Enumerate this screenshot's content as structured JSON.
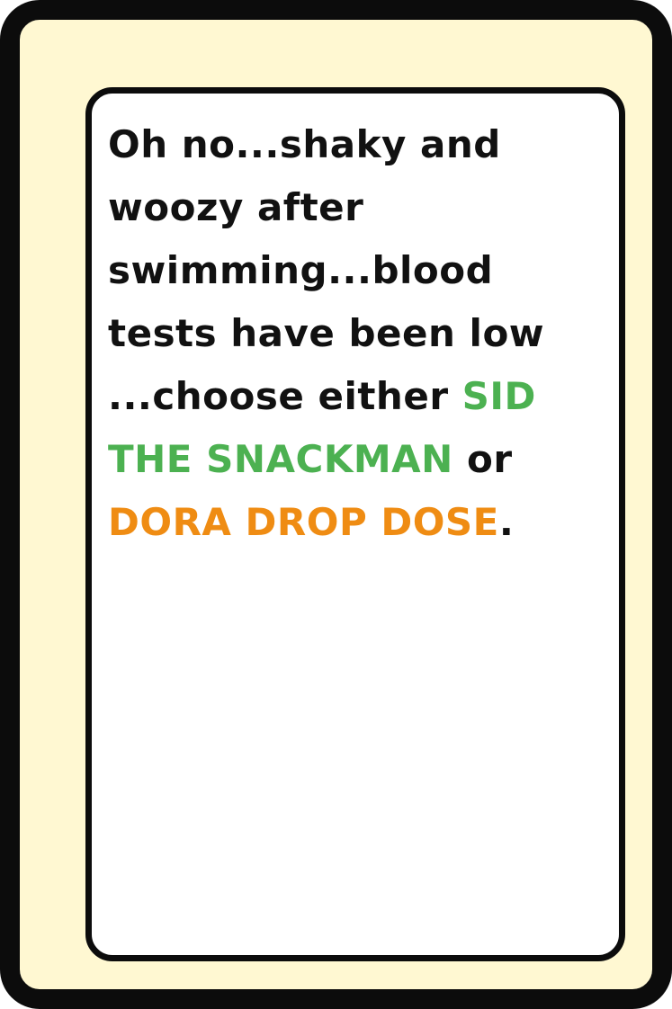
{
  "card": {
    "lines": [
      {
        "segments": [
          {
            "text": "Oh no...shaky and",
            "color": "default"
          }
        ]
      },
      {
        "segments": [
          {
            "text": "woozy after",
            "color": "default"
          }
        ]
      },
      {
        "segments": [
          {
            "text": "swimming...blood",
            "color": "default"
          }
        ]
      },
      {
        "segments": [
          {
            "text": "tests have been low",
            "color": "default"
          }
        ]
      },
      {
        "segments": [
          {
            "text": "...choose either ",
            "color": "default"
          },
          {
            "text": "SID",
            "color": "green"
          }
        ]
      },
      {
        "segments": [
          {
            "text": "THE SNACKMAN",
            "color": "green"
          },
          {
            "text": " or",
            "color": "default"
          }
        ]
      },
      {
        "segments": [
          {
            "text": "DORA DROP DOSE",
            "color": "orange"
          },
          {
            "text": ".",
            "color": "default"
          }
        ]
      }
    ]
  },
  "colors": {
    "border": "#0c0c0c",
    "card_background": "#fff8d2",
    "panel_background": "#ffffff",
    "text": "#111111",
    "green": "#4cb151",
    "orange": "#ef8c13"
  }
}
